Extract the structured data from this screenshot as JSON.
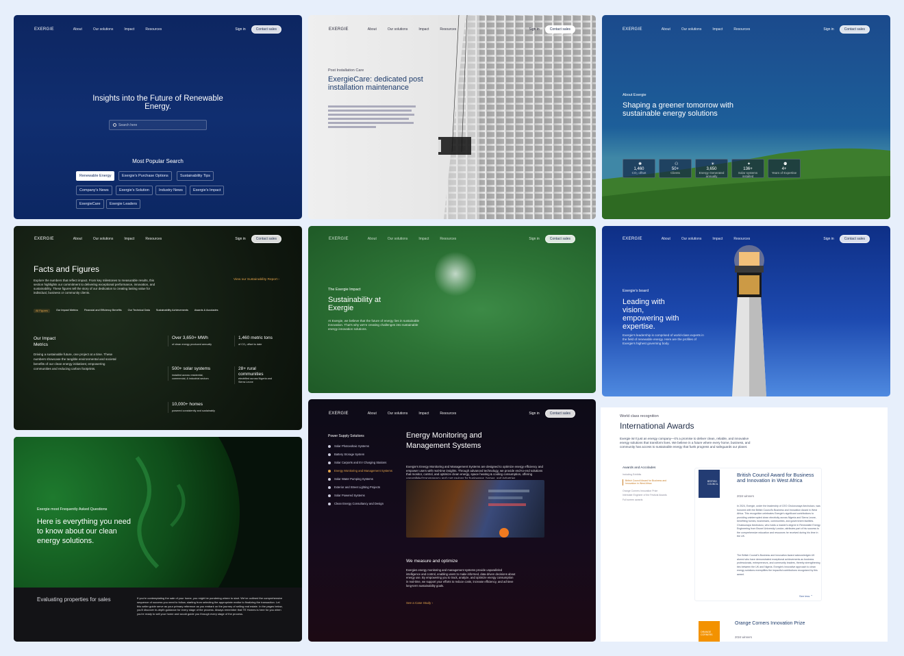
{
  "nav": {
    "logo": "EXERGIE",
    "about": "About",
    "solutions": "Our solutions",
    "impact": "Impact",
    "resources": "Resources",
    "signin": "Sign in",
    "cta": "Contact sales"
  },
  "insights": {
    "title": "Insights into the Future of Renewable Energy.",
    "search_placeholder": "Search here",
    "popular_heading": "Most Popular Search",
    "chips": [
      "Renewable Energy",
      "Exergie's Purchase Options",
      "Sustainability Tips",
      "Company's News",
      "Exergie's Solution",
      "Industry News",
      "Exergie's Impact",
      "ExergieCare",
      "Exergie Leaders"
    ]
  },
  "care": {
    "eyebrow": "Post Installation Care",
    "title": "ExergieCare: dedicated post installation maintenance"
  },
  "about": {
    "eyebrow": "About Exergie",
    "title": "Shaping a greener tomorrow with sustainable energy solutions",
    "stats": [
      {
        "value": "1,460",
        "label": "CO₂ offset"
      },
      {
        "value": "50+",
        "label": "Clients"
      },
      {
        "value": "3,650",
        "label": "Energy Generated annually"
      },
      {
        "value": "136+",
        "label": "Solar systems installed"
      },
      {
        "value": "4+",
        "label": "Years of Expertise"
      }
    ]
  },
  "facts": {
    "title": "Facts and Figures",
    "body": "Explore the numbers that reflect impact. From key milestones to measurable results, this section highlights our commitment to delivering exceptional performance, innovation, and sustainability. These figures tell the story of our dedication to creating lasting value for individual, business or community clients.",
    "report_link": "View our Sustainability Report",
    "tabs": [
      "All Figures",
      "Our Impact Metrics",
      "Financial and Efficiency Benefits",
      "Our Technical Data",
      "Sustainability Achievements",
      "Awards & Accolades"
    ],
    "impact_heading": "Our Impact Metrics",
    "impact_body": "Driving a sustainable future, one project at a time. These numbers showcase the tangible environmental and societal benefits of our clean energy initiatives; empowering communities and reducing carbon footprints.",
    "metrics": [
      {
        "value": "Over 3,650+ MWh",
        "label": "of clean energy produced annually"
      },
      {
        "value": "1,460 metric tons",
        "label": "of CO₂ offset to date"
      },
      {
        "value": "500+ solar systems",
        "label": "installed across residential, commercial, & industrial sectors"
      },
      {
        "value": "28+ rural communities",
        "label": "electrified across Nigeria and Sierra Leone"
      },
      {
        "value": "10,000+ homes",
        "label": "powered consistently and sustainably"
      }
    ]
  },
  "sustain": {
    "eyebrow": "The Exergie Impact",
    "title": "Sustainability at Exergie",
    "body": "At Exergie, we believe that the future of energy lies in sustainable innovation. That's why we're creating challenges into sustainable energy innovation solutions."
  },
  "board": {
    "eyebrow": "Exergie's board",
    "title": "Leading with vision, empowering with expertise.",
    "body": "Exergie's leadership is comprised of world-class experts in the field of renewable energy. Here are the profiles of Exergie's highest governing body."
  },
  "faq": {
    "eyebrow": "Exergie most Frequently Asked Questions",
    "title": "Here is everything you need to know about our clean energy solutions.",
    "question": "Evaluating properties for sales",
    "answer": "If you're contemplating the sale of your home, you might be pondering where to start. We've outlined the comprehensive sequence of success you need to follow, starting from selecting the appropriate realtor to finalizing the transaction. Let this seller guide serve as your primary reference as you embark on the journey of selling real estate. In the pages below, you'll discover in-depth guidance for every stage of the process. Always remember that TE Homes is here for you when you're ready to sell your home and would guide you through every stage of the process."
  },
  "monitoring": {
    "side_heading": "Power Supply Solutions",
    "side_items": [
      "Solar Photovoltaic Systems",
      "Battery Storage System",
      "Solar Carports and EV Charging Stations",
      "Energy Monitoring and Management Systems",
      "Solar Water Pumping Systems",
      "Exterior and Street Lighting Projects",
      "Solar Powered Systems",
      "Clean Energy Consultancy and Design"
    ],
    "title": "Energy Monitoring and Management Systems",
    "body": "Exergie's Energy Monitoring and Management Systems are designed to optimize energy efficiency and empower users with real-time insights. Through advanced technology, we provide end-to-end solutions that monitor, control, and optimize clean energy, space heating & cooling consumption, offering unparalleled transparency and cost savings for businesses, homes, and industries.",
    "sub_heading": "We measure and optimize",
    "sub_body": "Exergies energy monitoring and management systems provide unparalleled intelligence and control, enabling users to make informed, data-driven decisions about energy use. By empowering you to track, analyze, and optimize energy consumption in real-time, we support your efforts to reduce costs, increase efficiency, and achieve long-term sustainability goals.",
    "link": "See a Case Study"
  },
  "awards": {
    "eyebrow": "World class recognition",
    "title": "International Awards",
    "body": "Exergie isn't just an energy company—it's a promise to deliver clean, reliable, and innovative energy solutions that transform lives. We believe in a future where every home, business, and community has access to sustainable energy that fuels progress and safeguards our planet.",
    "side_heading": "Awards and Accolades",
    "side_items": [
      "Including Exhibits",
      "British Council Award for Business and Innovation in West Africa",
      "Orange Corners Innovation Prize",
      "Interstate Engineer of the Festival Awards",
      "Full screen awards"
    ],
    "bc_logo": "BRITISH COUNCIL",
    "bc_title": "British Council Award for Business and Innovation in West Africa",
    "bc_sub": "2024 winners",
    "bc_body1": "In 2024, Exergie, under the leadership of CEO Chukwunaya Ikechukwu, was honored with the British Council's Business and Innovation Award in West Africa. This recognition celebrates Exergie's significant contributions to providing uninterrupted clean electricity across Nigeria and Sierra Leone, benefiting homes, businesses, communities, and government facilities. Chukwunaya Ikechukwu, who holds a master's degree in Renewable Energy Engineering from Brunel University London, attributes part of his success to the comprehensive education and resources he received during his time in the UK.",
    "bc_body2": "The British Council's Business and Innovation Award acknowledges UK alumni who have demonstrated exceptional achievements as business professionals, entrepreneurs, and community leaders, thereby strengthening ties between the UK and Nigeria. Exergie's innovative approach to clean energy solutions exemplifies the impactful contributions recognized by this award.",
    "see_less": "See less",
    "oc_logo": "ORANGE CORNERS",
    "oc_title": "Orange Corners Innovation Prize",
    "oc_sub": "2024 winners"
  }
}
